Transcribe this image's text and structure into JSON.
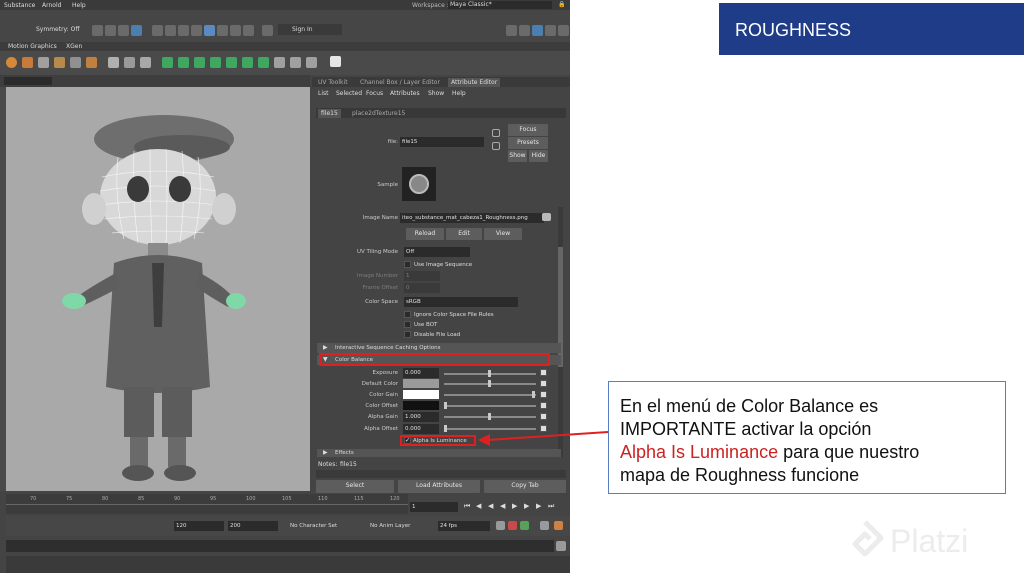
{
  "slide": {
    "title": "ROUGHNESS",
    "callout": {
      "line1": "En el menú de Color Balance es",
      "line2": "IMPORTANTE activar la opción",
      "highlight": "Alpha Is Luminance",
      "line3_rest": " para que nuestro",
      "line4": "mapa de Roughness funcione"
    },
    "watermark": "Platzi",
    "colors": {
      "title_bg": "#1f3c88",
      "highlight": "#cc2222",
      "annotation_red": "#e02020",
      "callout_border": "#5a7fc0"
    }
  },
  "maya": {
    "menubar": [
      "Substance",
      "Arnold",
      "Help"
    ],
    "symmetry": "Symmetry: Off",
    "sign_in": "Sign In",
    "workspace_label": "Workspace :",
    "workspace_value": "Maya Classic*",
    "shelf_tabs": [
      "Motion Graphics",
      "XGen"
    ],
    "attr_tabs": [
      "UV Toolkit",
      "Channel Box / Layer Editor",
      "Attribute Editor"
    ],
    "attr_menu": [
      "List",
      "Selected",
      "Focus",
      "Attributes",
      "Show",
      "Help"
    ],
    "node_tabs": [
      "file15",
      "place2dTexture15"
    ],
    "file_label": "file:",
    "file_value": "file15",
    "focus_btn": "Focus",
    "presets_btn": "Presets",
    "show_btn": "Show",
    "hide_btn": "Hide",
    "sample_label": "Sample",
    "image_name_label": "Image Name",
    "image_name_value": "iteo_substance_mat_cabeza1_Roughness.png",
    "reload_btn": "Reload",
    "edit_btn": "Edit",
    "view_btn": "View",
    "uv_tiling_label": "UV Tiling Mode",
    "uv_tiling_value": "Off",
    "use_image_sequence": "Use Image Sequence",
    "image_number_label": "Image Number",
    "image_number_value": "1",
    "frame_offset_label": "Frame Offset",
    "frame_offset_value": "0",
    "color_space_label": "Color Space",
    "color_space_value": "sRGB",
    "ignore_rules": "Ignore Color Space File Rules",
    "use_bot": "Use BOT",
    "disable_file_load": "Disable File Load",
    "section_interactive": "Interactive Sequence Caching Options",
    "section_color_balance": "Color Balance",
    "exposure_label": "Exposure",
    "exposure_value": "0.000",
    "default_color_label": "Default Color",
    "color_gain_label": "Color Gain",
    "color_offset_label": "Color Offset",
    "alpha_gain_label": "Alpha Gain",
    "alpha_gain_value": "1.000",
    "alpha_offset_label": "Alpha Offset",
    "alpha_offset_value": "0.000",
    "alpha_is_luminance": "Alpha Is Luminance",
    "section_effects": "Effects",
    "notes_label": "Notes:",
    "notes_value": "file15",
    "select_btn": "Select",
    "load_attributes_btn": "Load Attributes",
    "copy_tab_btn": "Copy Tab",
    "timeline_ticks": [
      "70",
      "75",
      "80",
      "85",
      "90",
      "95",
      "100",
      "105",
      "110",
      "115",
      "120"
    ],
    "current_frame": "1",
    "range_start": "120",
    "range_end": "200",
    "no_character_set": "No Character Set",
    "no_anim_layer": "No Anim Layer",
    "fps": "24 fps"
  }
}
